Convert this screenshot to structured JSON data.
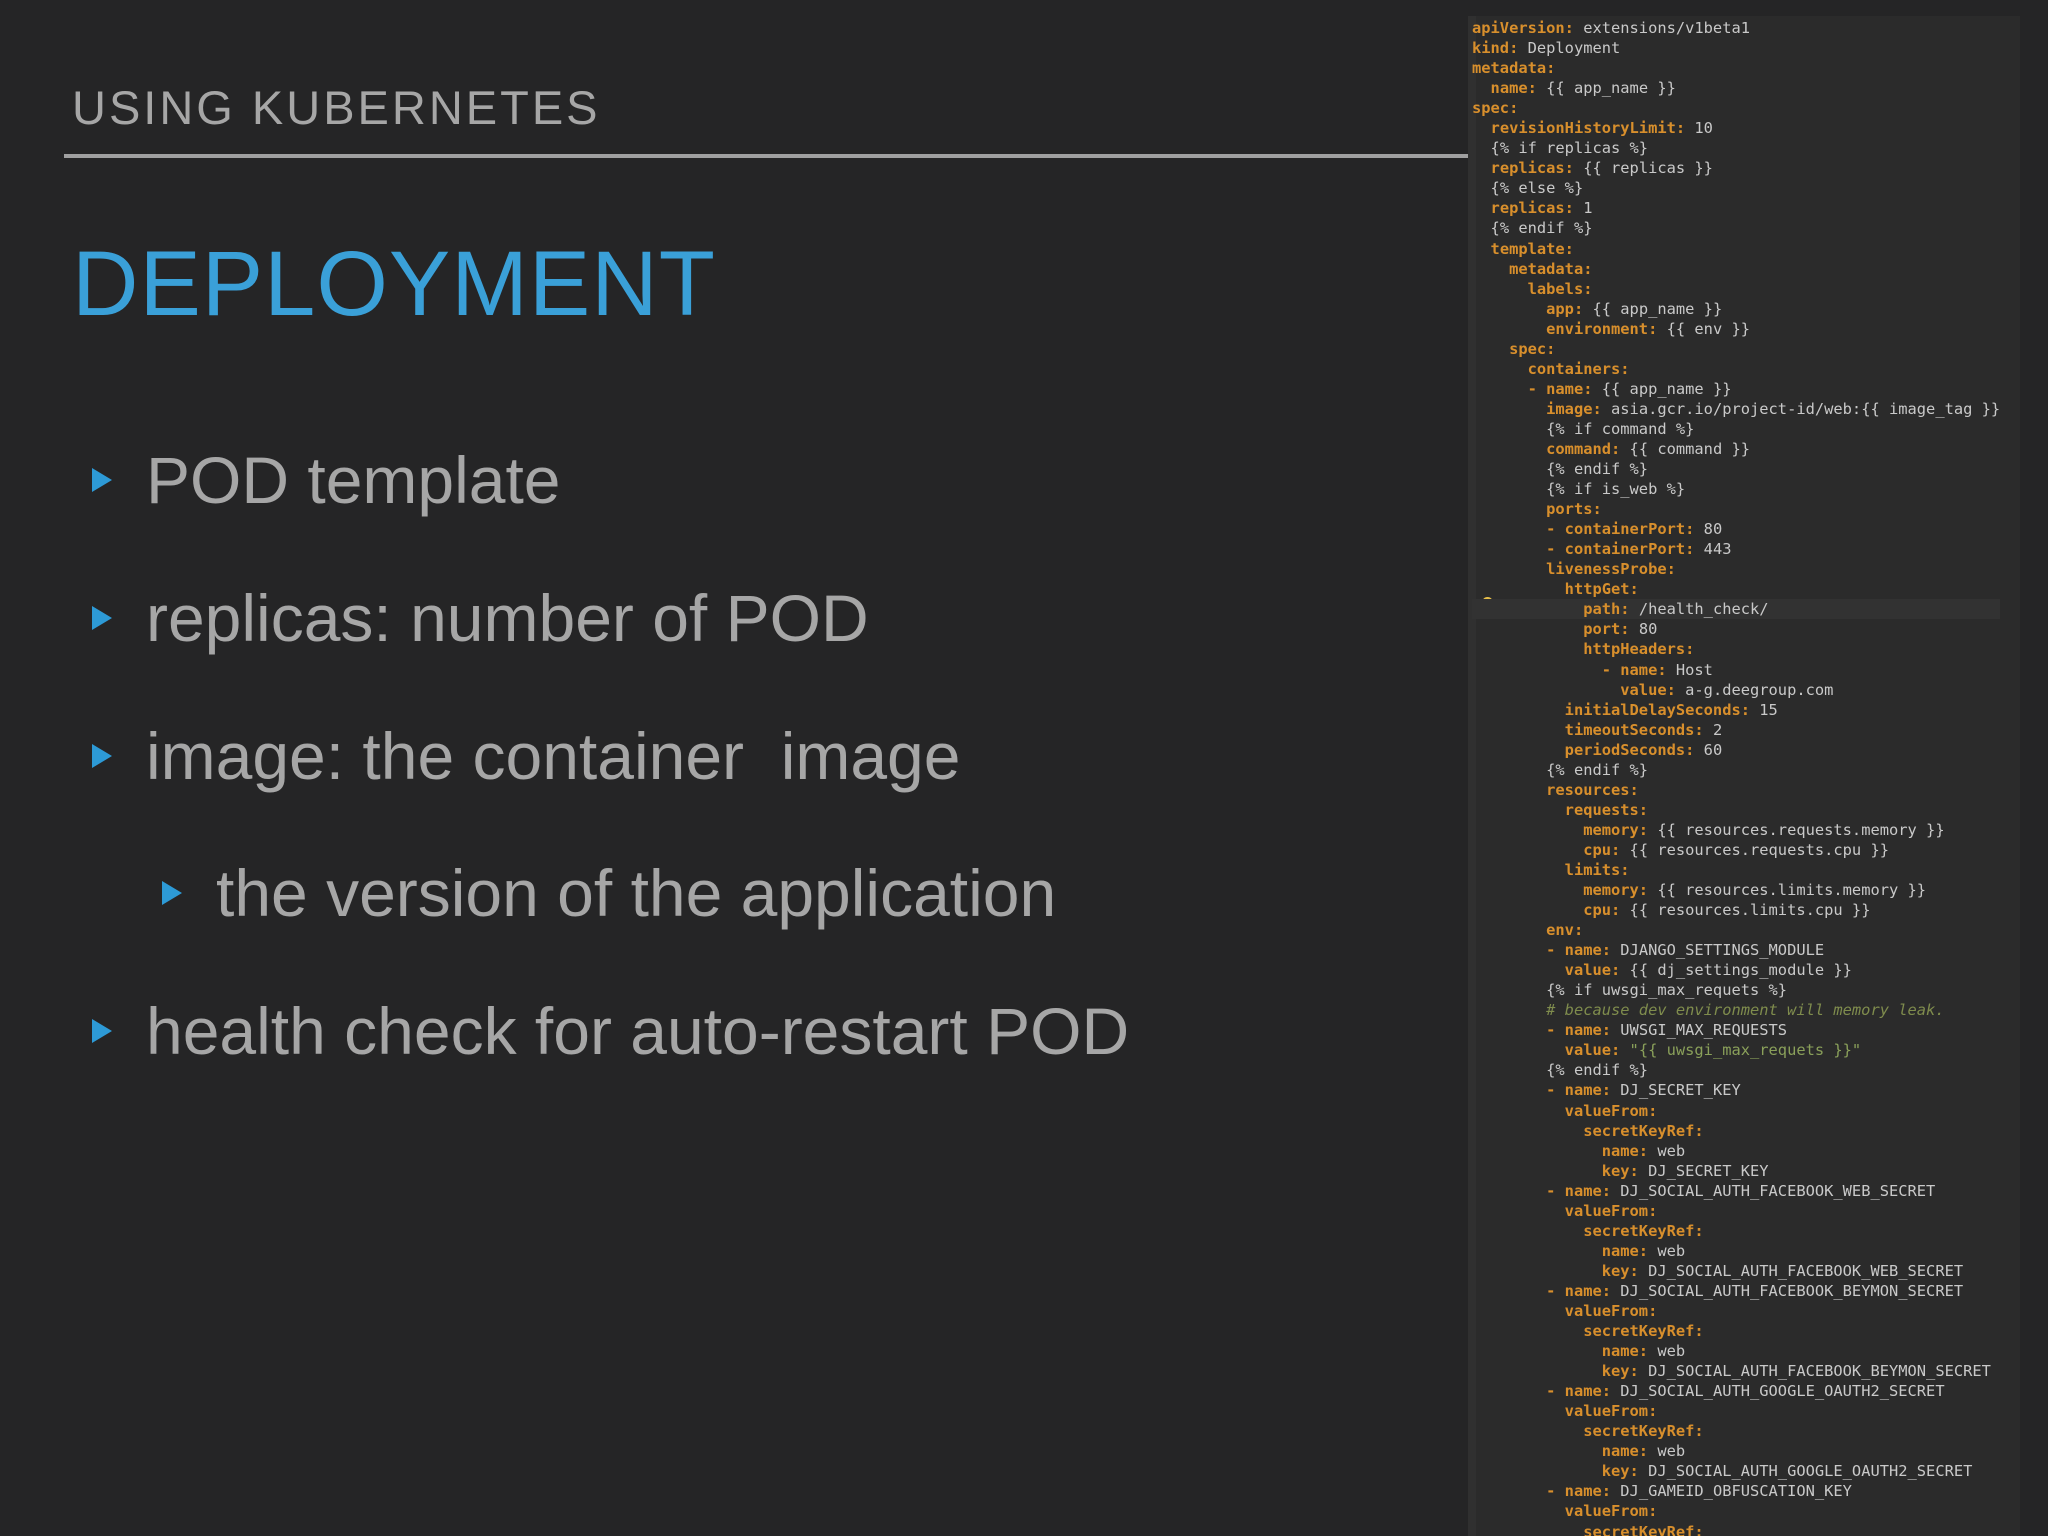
{
  "header": {
    "section": "USING KUBERNETES",
    "title": "DEPLOYMENT"
  },
  "bullets": [
    {
      "text": "POD template",
      "level": 1
    },
    {
      "text": "replicas: number of POD",
      "level": 1
    },
    {
      "text": "image: the container  image",
      "level": 1
    },
    {
      "text": "the version of the application",
      "level": 2
    },
    {
      "text": "health check for auto-restart POD",
      "level": 1
    }
  ],
  "colors": {
    "background": "#252526",
    "title": "#3aa0d8",
    "bullet_marker": "#2d9ad6",
    "text": "#a6a6a6",
    "yaml_key": "#d88f2c"
  },
  "code_lines": [
    {
      "indent": 0,
      "key": "apiVersion:",
      "value": " extensions/v1beta1"
    },
    {
      "indent": 0,
      "key": "kind:",
      "value": " Deployment"
    },
    {
      "indent": 0,
      "key": "metadata:",
      "value": ""
    },
    {
      "indent": 2,
      "key": "name:",
      "value": " {{ app_name }}"
    },
    {
      "indent": 0,
      "key": "spec:",
      "value": ""
    },
    {
      "indent": 2,
      "key": "revisionHistoryLimit:",
      "value": " 10"
    },
    {
      "indent": 2,
      "key": "",
      "value": "{% if replicas %}"
    },
    {
      "indent": 2,
      "key": "replicas:",
      "value": " {{ replicas }}"
    },
    {
      "indent": 2,
      "key": "",
      "value": "{% else %}"
    },
    {
      "indent": 2,
      "key": "replicas:",
      "value": " 1"
    },
    {
      "indent": 2,
      "key": "",
      "value": "{% endif %}"
    },
    {
      "indent": 2,
      "key": "template:",
      "value": ""
    },
    {
      "indent": 4,
      "key": "metadata:",
      "value": ""
    },
    {
      "indent": 6,
      "key": "labels:",
      "value": ""
    },
    {
      "indent": 8,
      "key": "app:",
      "value": " {{ app_name }}"
    },
    {
      "indent": 8,
      "key": "environment:",
      "value": " {{ env }}"
    },
    {
      "indent": 4,
      "key": "spec:",
      "value": ""
    },
    {
      "indent": 6,
      "key": "containers:",
      "value": ""
    },
    {
      "indent": 6,
      "key": "- name:",
      "value": " {{ app_name }}"
    },
    {
      "indent": 8,
      "key": "image:",
      "value": " asia.gcr.io/project-id/web:{{ image_tag }}"
    },
    {
      "indent": 8,
      "key": "",
      "value": "{% if command %}"
    },
    {
      "indent": 8,
      "key": "command:",
      "value": " {{ command }}"
    },
    {
      "indent": 8,
      "key": "",
      "value": "{% endif %}"
    },
    {
      "indent": 8,
      "key": "",
      "value": "{% if is_web %}"
    },
    {
      "indent": 8,
      "key": "ports:",
      "value": ""
    },
    {
      "indent": 8,
      "key": "- containerPort:",
      "value": " 80"
    },
    {
      "indent": 8,
      "key": "- containerPort:",
      "value": " 443"
    },
    {
      "indent": 8,
      "key": "livenessProbe:",
      "value": ""
    },
    {
      "indent": 10,
      "key": "httpGet:",
      "value": ""
    },
    {
      "indent": 12,
      "key": "path:",
      "value": " /health_check/",
      "highlight": true
    },
    {
      "indent": 12,
      "key": "port:",
      "value": " 80"
    },
    {
      "indent": 12,
      "key": "httpHeaders:",
      "value": ""
    },
    {
      "indent": 14,
      "key": "- name:",
      "value": " Host"
    },
    {
      "indent": 16,
      "key": "value:",
      "value": " a-g.deegroup.com"
    },
    {
      "indent": 10,
      "key": "initialDelaySeconds:",
      "value": " 15"
    },
    {
      "indent": 10,
      "key": "timeoutSeconds:",
      "value": " 2"
    },
    {
      "indent": 10,
      "key": "periodSeconds:",
      "value": " 60"
    },
    {
      "indent": 8,
      "key": "",
      "value": "{% endif %}"
    },
    {
      "indent": 8,
      "key": "resources:",
      "value": ""
    },
    {
      "indent": 10,
      "key": "requests:",
      "value": ""
    },
    {
      "indent": 12,
      "key": "memory:",
      "value": " {{ resources.requests.memory }}"
    },
    {
      "indent": 12,
      "key": "cpu:",
      "value": " {{ resources.requests.cpu }}"
    },
    {
      "indent": 10,
      "key": "limits:",
      "value": ""
    },
    {
      "indent": 12,
      "key": "memory:",
      "value": " {{ resources.limits.memory }}"
    },
    {
      "indent": 12,
      "key": "cpu:",
      "value": " {{ resources.limits.cpu }}"
    },
    {
      "indent": 8,
      "key": "env:",
      "value": ""
    },
    {
      "indent": 8,
      "key": "- name:",
      "value": " DJANGO_SETTINGS_MODULE"
    },
    {
      "indent": 10,
      "key": "value:",
      "value": " {{ dj_settings_module }}"
    },
    {
      "indent": 8,
      "key": "",
      "value": "{% if uwsgi_max_requets %}"
    },
    {
      "indent": 8,
      "key": "",
      "value": "",
      "comment": "# because dev environment will memory leak."
    },
    {
      "indent": 8,
      "key": "- name:",
      "value": " UWSGI_MAX_REQUESTS"
    },
    {
      "indent": 10,
      "key": "value:",
      "value": "",
      "string": " \"{{ uwsgi_max_requets }}\""
    },
    {
      "indent": 8,
      "key": "",
      "value": "{% endif %}"
    },
    {
      "indent": 8,
      "key": "- name:",
      "value": " DJ_SECRET_KEY"
    },
    {
      "indent": 10,
      "key": "valueFrom:",
      "value": ""
    },
    {
      "indent": 12,
      "key": "secretKeyRef:",
      "value": ""
    },
    {
      "indent": 14,
      "key": "name:",
      "value": " web"
    },
    {
      "indent": 14,
      "key": "key:",
      "value": " DJ_SECRET_KEY"
    },
    {
      "indent": 8,
      "key": "- name:",
      "value": " DJ_SOCIAL_AUTH_FACEBOOK_WEB_SECRET"
    },
    {
      "indent": 10,
      "key": "valueFrom:",
      "value": ""
    },
    {
      "indent": 12,
      "key": "secretKeyRef:",
      "value": ""
    },
    {
      "indent": 14,
      "key": "name:",
      "value": " web"
    },
    {
      "indent": 14,
      "key": "key:",
      "value": " DJ_SOCIAL_AUTH_FACEBOOK_WEB_SECRET"
    },
    {
      "indent": 8,
      "key": "- name:",
      "value": " DJ_SOCIAL_AUTH_FACEBOOK_BEYMON_SECRET"
    },
    {
      "indent": 10,
      "key": "valueFrom:",
      "value": ""
    },
    {
      "indent": 12,
      "key": "secretKeyRef:",
      "value": ""
    },
    {
      "indent": 14,
      "key": "name:",
      "value": " web"
    },
    {
      "indent": 14,
      "key": "key:",
      "value": " DJ_SOCIAL_AUTH_FACEBOOK_BEYMON_SECRET"
    },
    {
      "indent": 8,
      "key": "- name:",
      "value": " DJ_SOCIAL_AUTH_GOOGLE_OAUTH2_SECRET"
    },
    {
      "indent": 10,
      "key": "valueFrom:",
      "value": ""
    },
    {
      "indent": 12,
      "key": "secretKeyRef:",
      "value": ""
    },
    {
      "indent": 14,
      "key": "name:",
      "value": " web"
    },
    {
      "indent": 14,
      "key": "key:",
      "value": " DJ_SOCIAL_AUTH_GOOGLE_OAUTH2_SECRET"
    },
    {
      "indent": 8,
      "key": "- name:",
      "value": " DJ_GAMEID_OBFUSCATION_KEY"
    },
    {
      "indent": 10,
      "key": "valueFrom:",
      "value": ""
    },
    {
      "indent": 12,
      "key": "secretKeyRef:",
      "value": ""
    }
  ]
}
